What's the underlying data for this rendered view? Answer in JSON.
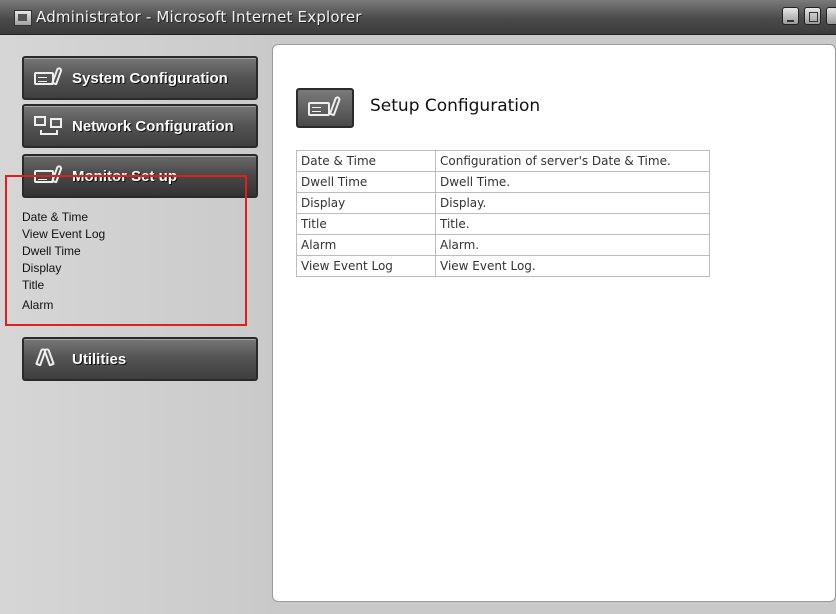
{
  "window": {
    "title": "Administrator - Microsoft Internet Explorer"
  },
  "sidebar": {
    "system_configuration": "System Configuration",
    "network_configuration": "Network Configuration",
    "monitor_setup": "Monitor Set up",
    "utilities": "Utilities",
    "submenu": [
      "Date & Time",
      "View Event Log",
      "Dwell Time",
      "Display",
      "Title",
      "Alarm"
    ]
  },
  "main": {
    "title": "Setup Configuration",
    "rows": [
      {
        "name": "Date & Time",
        "desc": "Configuration of server's Date & Time."
      },
      {
        "name": "Dwell Time",
        "desc": "Dwell Time."
      },
      {
        "name": "Display",
        "desc": "Display."
      },
      {
        "name": "Title",
        "desc": "Title."
      },
      {
        "name": "Alarm",
        "desc": "Alarm."
      },
      {
        "name": "View Event Log",
        "desc": "View Event Log."
      }
    ]
  },
  "colors": {
    "highlight_border": "#e0201c",
    "button_dark": "#4a4a4a"
  }
}
